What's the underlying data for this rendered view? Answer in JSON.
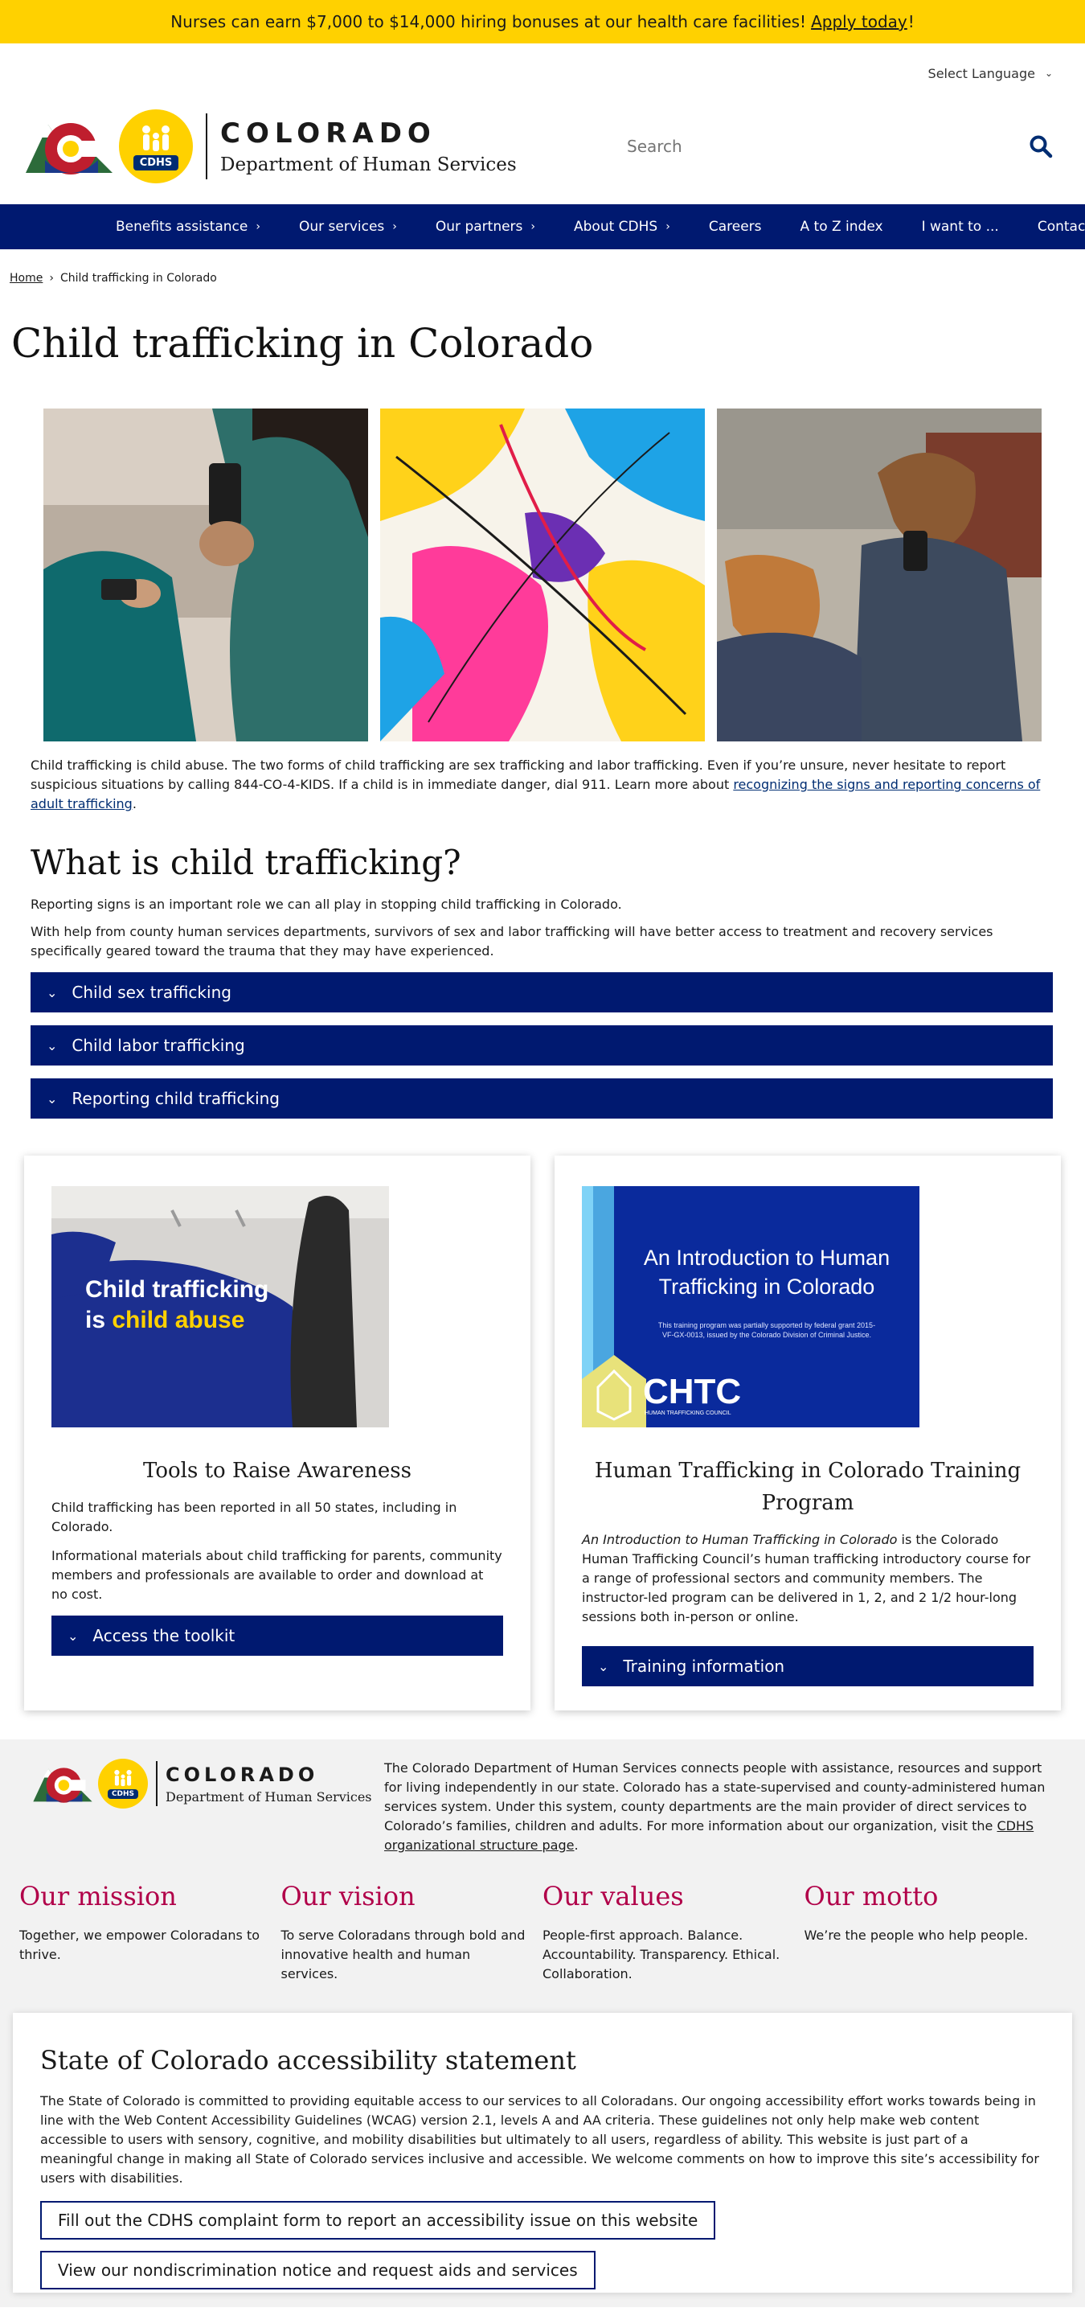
{
  "alert": {
    "text": "Nurses can earn $7,000 to $14,000 hiring bonuses at our health care facilities!",
    "link": "Apply today",
    "end": "!"
  },
  "language": {
    "label": "Select Language"
  },
  "header": {
    "state": "COLORADO",
    "department": "Department of Human Services",
    "badge": "CDHS",
    "search_placeholder": "Search"
  },
  "nav": {
    "items": [
      {
        "label": "Benefits assistance",
        "chev": "›"
      },
      {
        "label": "Our services",
        "chev": "›"
      },
      {
        "label": "Our partners",
        "chev": "›"
      },
      {
        "label": "About CDHS",
        "chev": "›"
      },
      {
        "label": "Careers"
      },
      {
        "label": "A to Z index"
      },
      {
        "label": "I want to ..."
      },
      {
        "label": "Contact us"
      }
    ]
  },
  "breadcrumb": {
    "home": "Home",
    "sep": "›",
    "current": "Child trafficking in Colorado"
  },
  "page": {
    "title": "Child trafficking in Colorado",
    "intro_text": "Child trafficking is child abuse. The two forms of child trafficking are sex trafficking and labor trafficking. Even if you’re unsure, never hesitate to report suspicious situations by calling 844-CO-4-KIDS. If a child is in immediate danger, dial 911. Learn more about ",
    "intro_link": "recognizing the signs and reporting concerns of adult trafficking",
    "intro_end": "."
  },
  "what": {
    "heading": "What is child trafficking?",
    "p1": "Reporting signs is an important role we can all play in stopping child trafficking in Colorado.",
    "p2": "With help from county human services departments, survivors of sex and labor trafficking will have better access to treatment and recovery services specifically geared toward the trauma that they may have experienced.",
    "accordions": [
      "Child sex trafficking",
      "Child labor trafficking",
      "Reporting child trafficking"
    ]
  },
  "cards": {
    "tools": {
      "img_line1": "Child trafficking",
      "img_line2a": "is ",
      "img_line2b": "child abuse",
      "title": "Tools to Raise Awareness",
      "p1": "Child trafficking has been reported in all 50 states, including in Colorado.",
      "p2": "Informational materials about child trafficking for parents, community members and professionals are available to order and download at no cost.",
      "button": "Access the toolkit"
    },
    "training": {
      "img_title": "An Introduction to Human Trafficking in Colorado",
      "img_note": "This training program was partially supported by federal grant 2015-VF-GX-0013, issued by the Colorado Division of Criminal Justice.",
      "img_brand": "CHTC",
      "img_brand_sub": "HUMAN TRAFFICKING COUNCIL",
      "title": "Human Trafficking in Colorado Training Program",
      "p_em": "An Introduction to Human Trafficking in Colorado",
      "p_rest": " is the Colorado Human Trafficking Council’s human trafficking introductory course for a range of professional sectors and community members. The instructor-led program can be delivered in 1, 2, and 2 1/2 hour-long sessions both in-person or online.",
      "button": "Training information"
    }
  },
  "footer": {
    "about_text": "The Colorado Department of Human Services connects people with assistance, resources and support for living independently in our state. Colorado has a state-supervised and county-administered human services system. Under this system, county departments are the main provider of direct services to Colorado’s families, children and adults. For more information about our organization, visit the ",
    "about_link": "CDHS organizational structure page",
    "about_end": ".",
    "pillars": [
      {
        "title": "Our mission",
        "text": "Together, we empower Coloradans to thrive."
      },
      {
        "title": "Our vision",
        "text": "To serve Coloradans through bold and innovative health and human services."
      },
      {
        "title": "Our values",
        "text": "People-first approach. Balance. Accountability. Transparency. Ethical. Collaboration."
      },
      {
        "title": "Our motto",
        "text": "We’re the people who help people."
      }
    ],
    "a11y": {
      "heading": "State of Colorado accessibility statement",
      "text": "The State of Colorado is committed to providing equitable access to our services to all Coloradans. Our ongoing accessibility effort works towards being in line with the Web Content Accessibility Guidelines (WCAG) version 2.1, levels A and AA criteria. These guidelines not only help make web content accessible to users with sensory, cognitive, and mobility disabilities but ultimately to all users, regardless of ability. This website is just part of a meaningful change in making all State of Colorado services inclusive and accessible. We welcome comments on how to improve this site’s accessibility for users with disabilities.",
      "btn1": "Fill out the CDHS complaint form to report an accessibility issue on this website",
      "btn2": "View our nondiscrimination notice and request aids and services"
    }
  },
  "colors": {
    "brand_blue": "#001970",
    "alert_yellow": "#ffd100",
    "accent_red": "#b10049"
  }
}
